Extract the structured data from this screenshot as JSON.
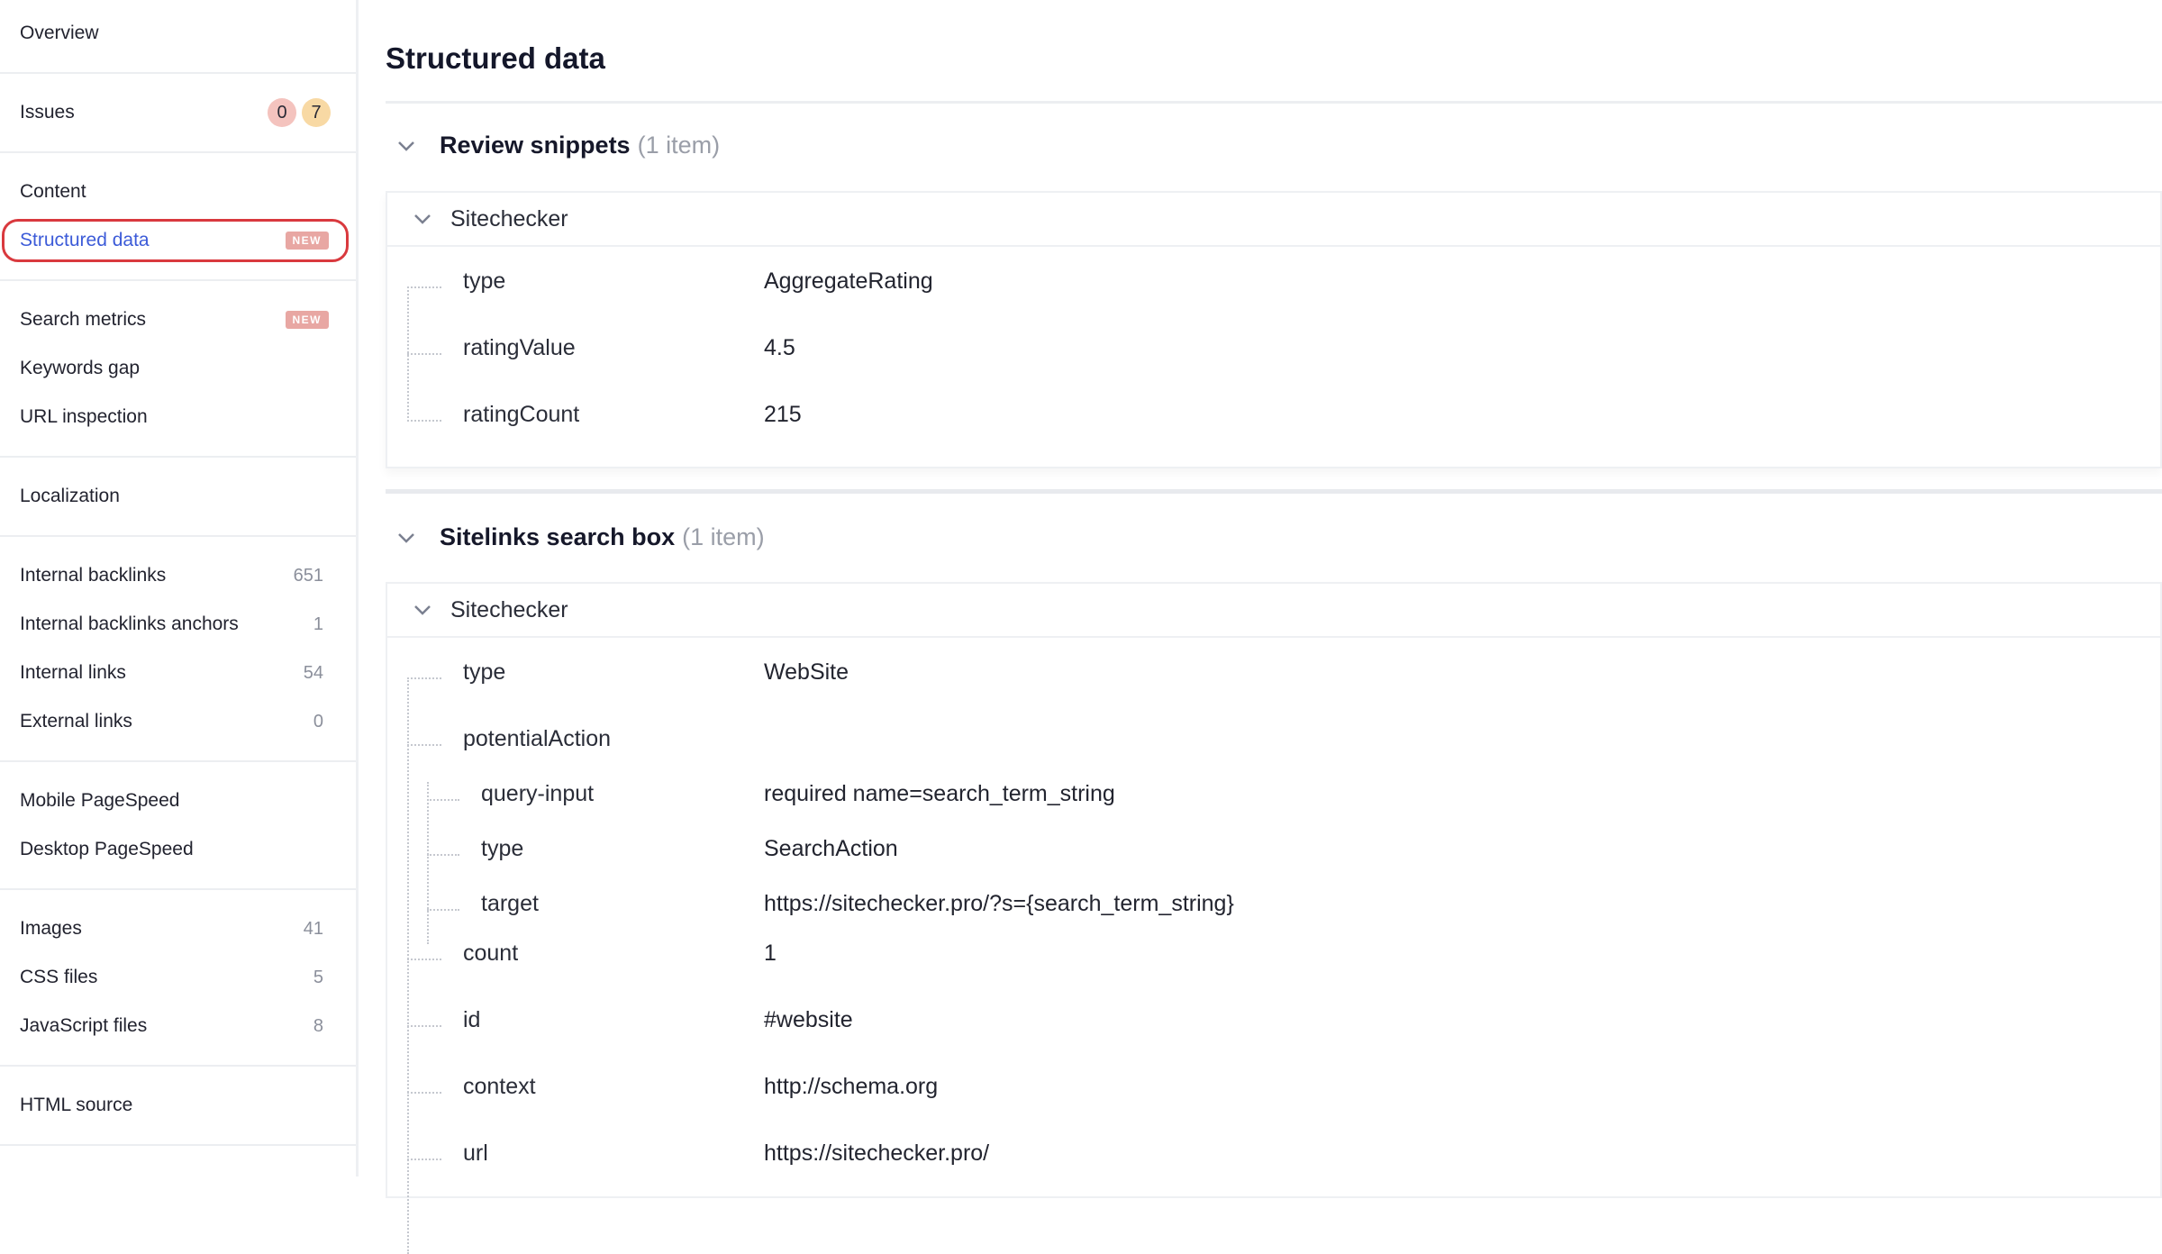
{
  "sidebar": {
    "overview": "Overview",
    "issues": {
      "label": "Issues",
      "errors": "0",
      "warnings": "7"
    },
    "content": "Content",
    "structured_data": {
      "label": "Structured data",
      "badge": "NEW"
    },
    "search_metrics": {
      "label": "Search metrics",
      "badge": "NEW"
    },
    "keywords_gap": "Keywords gap",
    "url_inspection": "URL inspection",
    "localization": "Localization",
    "internal_backlinks": {
      "label": "Internal backlinks",
      "count": "651"
    },
    "internal_backlinks_anchors": {
      "label": "Internal backlinks anchors",
      "count": "1"
    },
    "internal_links": {
      "label": "Internal links",
      "count": "54"
    },
    "external_links": {
      "label": "External links",
      "count": "0"
    },
    "mobile_pagespeed": "Mobile PageSpeed",
    "desktop_pagespeed": "Desktop PageSpeed",
    "images": {
      "label": "Images",
      "count": "41"
    },
    "css_files": {
      "label": "CSS files",
      "count": "5"
    },
    "javascript_files": {
      "label": "JavaScript files",
      "count": "8"
    },
    "html_source": "HTML source"
  },
  "main": {
    "title": "Structured data",
    "review": {
      "name": "Review snippets",
      "meta": "(1 item)",
      "entity": "Sitechecker",
      "rows": [
        {
          "key": "type",
          "value": "AggregateRating"
        },
        {
          "key": "ratingValue",
          "value": "4.5"
        },
        {
          "key": "ratingCount",
          "value": "215"
        }
      ]
    },
    "sitelinks": {
      "name": "Sitelinks search box",
      "meta": "(1 item)",
      "entity": "Sitechecker",
      "rows": [
        {
          "key": "type",
          "value": "WebSite"
        },
        {
          "key": "potentialAction",
          "value": ""
        },
        {
          "key": "query-input",
          "value": "required name=search_term_string"
        },
        {
          "key": "type",
          "value": "SearchAction"
        },
        {
          "key": "target",
          "value": "https://sitechecker.pro/?s={search_term_string}"
        },
        {
          "key": "count",
          "value": "1"
        },
        {
          "key": "id",
          "value": "#website"
        },
        {
          "key": "context",
          "value": "http://schema.org"
        },
        {
          "key": "url",
          "value": "https://sitechecker.pro/"
        }
      ]
    }
  },
  "colors": {
    "active_link": "#3c5bd8",
    "active_outline": "#d9393e",
    "badge_new": "#e8a7a3",
    "issue_error": "#f4c3be",
    "issue_warning": "#f8d9a4"
  }
}
